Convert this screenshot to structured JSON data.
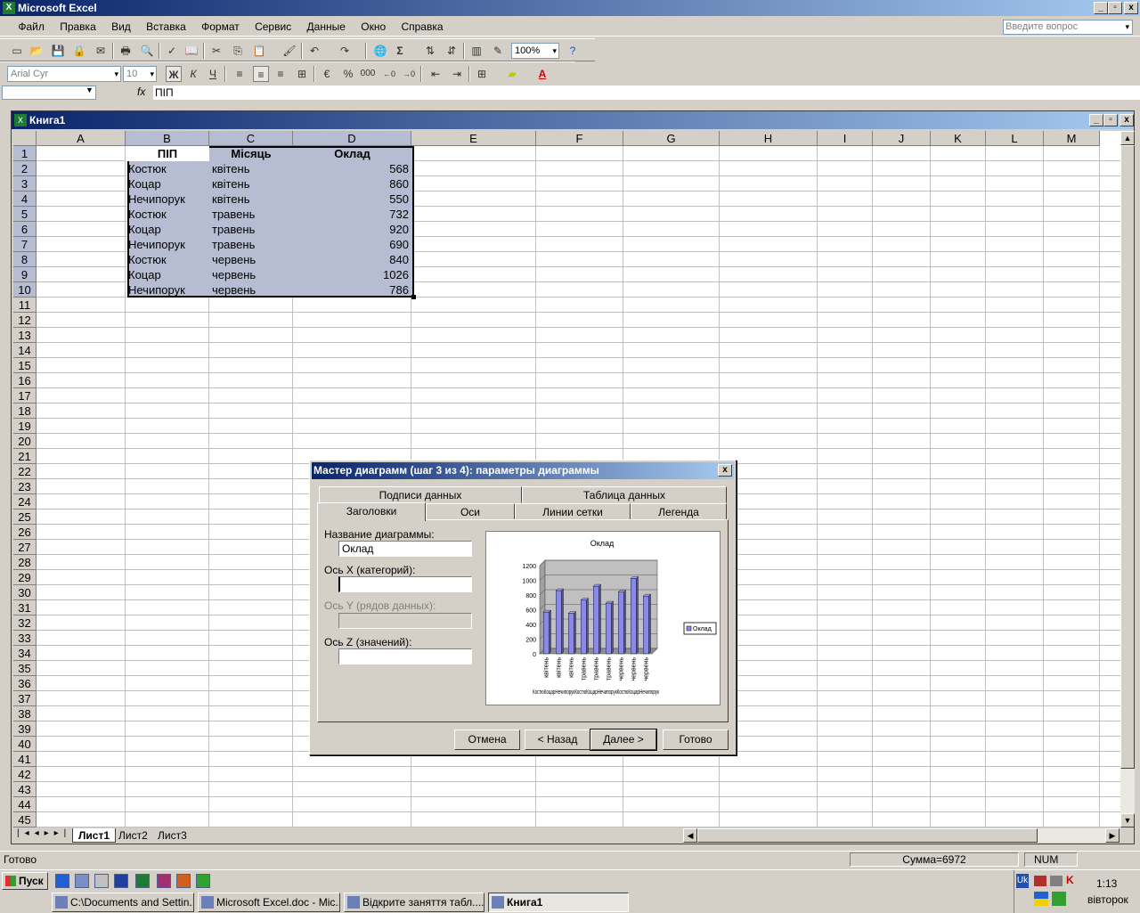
{
  "app": {
    "title": "Microsoft Excel",
    "window_min": "_",
    "window_max": "▫",
    "window_close": "x"
  },
  "menu": [
    "Файл",
    "Правка",
    "Вид",
    "Вставка",
    "Формат",
    "Сервис",
    "Данные",
    "Окно",
    "Справка"
  ],
  "ask_placeholder": "Введите вопрос",
  "toolbar": {
    "zoom": "100%",
    "font_name": "Arial Cyr",
    "font_size": "10",
    "bold": "Ж",
    "italic": "К",
    "underline": "Ч",
    "percent": "%",
    "thousands": "000",
    "sigma": "Σ"
  },
  "formula_bar": {
    "name_box": "",
    "fx": "fx",
    "content": "ПІП"
  },
  "workbook": {
    "title": "Книга1"
  },
  "columns": [
    "A",
    "B",
    "C",
    "D",
    "E",
    "F",
    "G",
    "H",
    "I",
    "J",
    "K",
    "L",
    "M"
  ],
  "rows": [
    "1",
    "2",
    "3",
    "4",
    "5",
    "6",
    "7",
    "8",
    "9",
    "10",
    "11",
    "12",
    "13",
    "14",
    "15",
    "16",
    "17",
    "18",
    "19",
    "20",
    "21",
    "22",
    "23",
    "24",
    "25",
    "26",
    "27",
    "28",
    "29",
    "30",
    "31",
    "32",
    "33",
    "34",
    "35",
    "36",
    "37",
    "38",
    "39",
    "40",
    "41",
    "42",
    "43",
    "44",
    "45"
  ],
  "table": {
    "headers": [
      "ПІП",
      "Місяць",
      "Оклад"
    ],
    "data": [
      [
        "Костюк",
        "квітень",
        "568"
      ],
      [
        "Коцар",
        "квітень",
        "860"
      ],
      [
        "Нечипорук",
        "квітень",
        "550"
      ],
      [
        "Костюк",
        "травень",
        "732"
      ],
      [
        "Коцар",
        "травень",
        "920"
      ],
      [
        "Нечипорук",
        "травень",
        "690"
      ],
      [
        "Костюк",
        "червень",
        "840"
      ],
      [
        "Коцар",
        "червень",
        "1026"
      ],
      [
        "Нечипорук",
        "червень",
        "786"
      ]
    ]
  },
  "sheets": [
    "Лист1",
    "Лист2",
    "Лист3"
  ],
  "status": {
    "left": "Готово",
    "sum": "Сумма=6972",
    "num": "NUM"
  },
  "dialog": {
    "title": "Мастер диаграмм (шаг 3 из 4): параметры диаграммы",
    "close": "x",
    "tabs_back": [
      "Подписи данных",
      "Таблица данных"
    ],
    "tabs_front": [
      "Заголовки",
      "Оси",
      "Линии сетки",
      "Легенда"
    ],
    "fields": [
      {
        "label": "Название диаграммы:",
        "value": "Оклад"
      },
      {
        "label": "Ось X (категорий):",
        "value": ""
      },
      {
        "label": "Ось Y (рядов данных):",
        "value": ""
      },
      {
        "label": "Ось Z (значений):",
        "value": ""
      }
    ],
    "buttons": [
      "Отмена",
      "< Назад",
      "Далее >",
      "Готово"
    ]
  },
  "chart_data": {
    "type": "bar",
    "title": "Оклад",
    "categories": [
      "квітень",
      "квітень",
      "квітень",
      "травень",
      "травень",
      "травень",
      "червень",
      "червень",
      "червень"
    ],
    "values": [
      568,
      860,
      550,
      732,
      920,
      690,
      840,
      1026,
      786
    ],
    "yticks": [
      "1200",
      "1000",
      "800",
      "600",
      "400",
      "200",
      "0"
    ],
    "ylim": [
      0,
      1200
    ],
    "xlabel_bottom": "КостюКоцарНечипорукКостюКоцарНечипорукКостюКоцарНечипорук",
    "series": [
      {
        "name": "Оклад",
        "values": [
          568,
          860,
          550,
          732,
          920,
          690,
          840,
          1026,
          786
        ]
      }
    ],
    "legend": "right",
    "bar_color": "#8888ee"
  },
  "taskbar": {
    "start": "Пуск",
    "buttons": [
      "C:\\Documents and Settin...",
      "Microsoft Excel.doc - Mic...",
      "Відкрите заняття табл....",
      "Книга1"
    ],
    "clock": "1:13",
    "day": "вівторок",
    "lang": "Uk"
  }
}
